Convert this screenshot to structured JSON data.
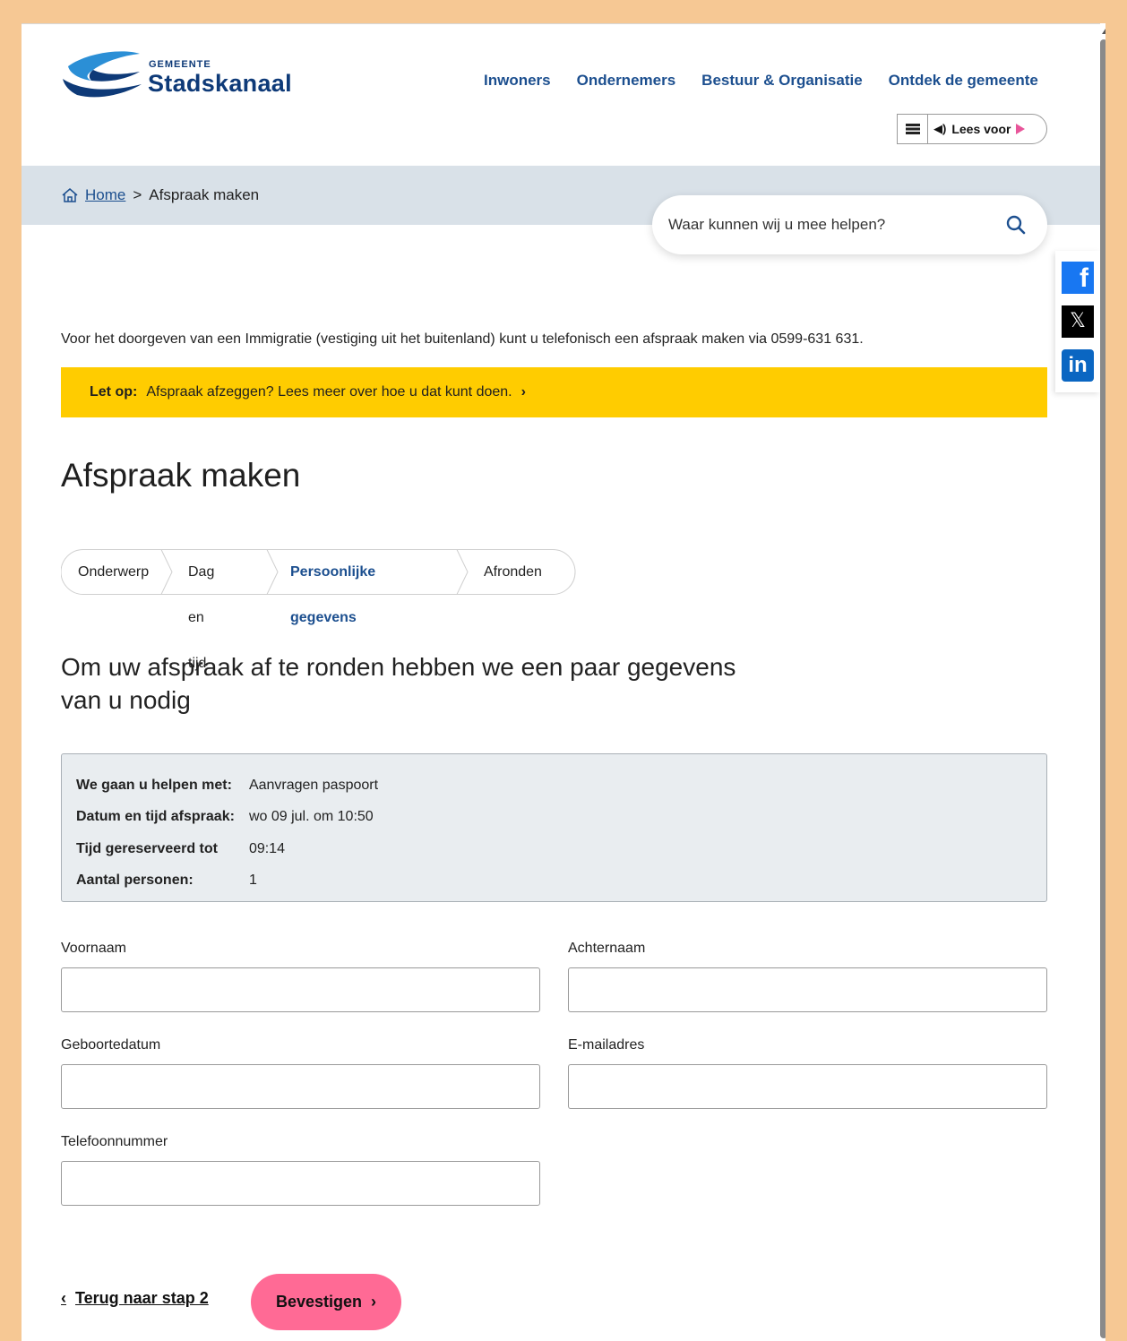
{
  "logo": {
    "small": "GEMEENTE",
    "big": "Stadskanaal"
  },
  "nav": [
    "Inwoners",
    "Ondernemers",
    "Bestuur & Organisatie",
    "Ontdek de gemeente"
  ],
  "reader": {
    "label": "Lees voor"
  },
  "breadcrumb": {
    "home": "Home",
    "separator": ">",
    "current": "Afspraak maken"
  },
  "search": {
    "placeholder": "Waar kunnen wij u mee helpen?"
  },
  "intro": "Voor het doorgeven van een Immigratie (vestiging uit het buitenland) kunt u telefonisch een afspraak maken via 0599-631 631.",
  "notice": {
    "label": "Let op:",
    "text": "Afspraak afzeggen? Lees meer over hoe u dat kunt doen.",
    "chevron": "›",
    "color": "#ffcc00"
  },
  "title": "Afspraak maken",
  "steps": [
    {
      "label": "Onderwerp",
      "active": false
    },
    {
      "label": "Dag en tijd",
      "active": false
    },
    {
      "label": "Persoonlijke gegevens",
      "active": true
    },
    {
      "label": "Afronden",
      "active": false
    }
  ],
  "subtitle": "Om uw afspraak af te ronden hebben we een paar gegevens van u nodig",
  "summary": [
    {
      "key": "We gaan u helpen met:",
      "value": "Aanvragen paspoort"
    },
    {
      "key": "Datum en tijd afspraak:",
      "value": "wo 09 jul. om 10:50"
    },
    {
      "key": "Tijd gereserveerd tot",
      "value": "09:14"
    },
    {
      "key": "Aantal personen:",
      "value": "1"
    }
  ],
  "form": {
    "voornaam": {
      "label": "Voornaam",
      "value": ""
    },
    "achternaam": {
      "label": "Achternaam",
      "value": ""
    },
    "geboortedatum": {
      "label": "Geboortedatum",
      "value": ""
    },
    "email": {
      "label": "E-mailadres",
      "value": ""
    },
    "telefoon": {
      "label": "Telefoonnummer",
      "value": ""
    }
  },
  "actions": {
    "back": "Terug naar stap 2",
    "confirm": "Bevestigen",
    "back_chevron": "‹",
    "next_chevron": "›"
  },
  "social": {
    "facebook": "f",
    "x": "𝕏",
    "linkedin": "in"
  },
  "colors": {
    "brand": "#1c4f8f",
    "accent": "#ff6a95",
    "notice": "#ffcc00"
  },
  "icons": [
    "home-icon",
    "search-icon",
    "menu-icon",
    "speaker-icon",
    "play-icon",
    "facebook-icon",
    "x-icon",
    "linkedin-icon",
    "chevron-right-icon",
    "chevron-left-icon"
  ]
}
